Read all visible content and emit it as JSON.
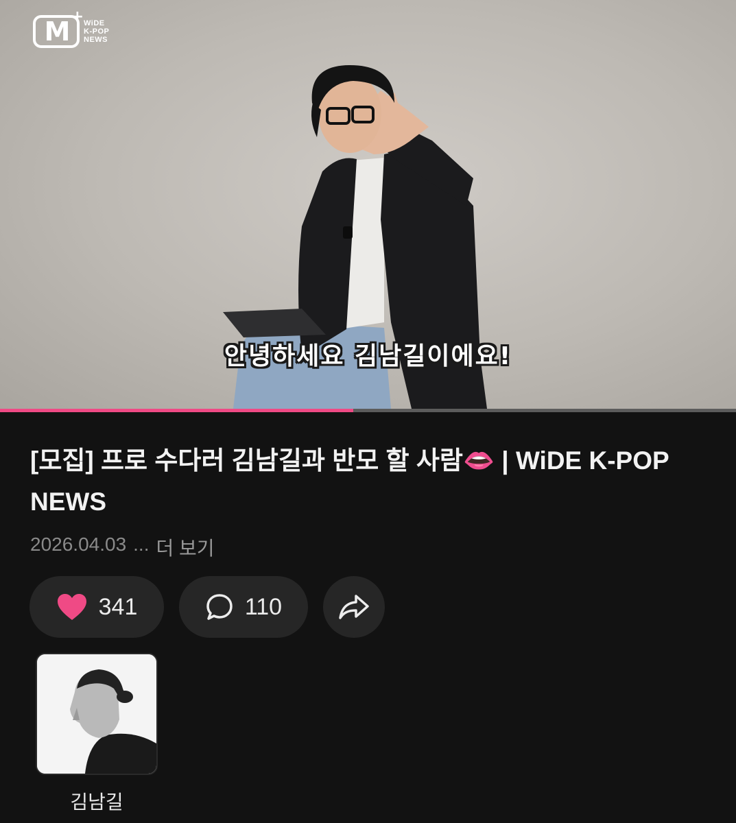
{
  "video": {
    "logo": {
      "mark": "M",
      "plus": "+",
      "line1": "WiDE",
      "line2": "K-POP",
      "line3": "NEWS"
    },
    "subtitle": "안녕하세요 김남길이에요!",
    "progress_fraction": 0.48
  },
  "post": {
    "title": "[모집] 프로 수다러 김남길과 반모 할 사람👄 | WiDE K-POP NEWS",
    "date": "2026.04.03",
    "ellipsis": "...",
    "more_label": "더 보기"
  },
  "actions": {
    "likes": "341",
    "comments": "110"
  },
  "artist": {
    "name": "김남길"
  },
  "colors": {
    "accent": "#ef4a85",
    "background": "#121212",
    "pill": "#262626"
  },
  "icons": [
    "heart-icon",
    "comment-icon",
    "share-icon"
  ]
}
